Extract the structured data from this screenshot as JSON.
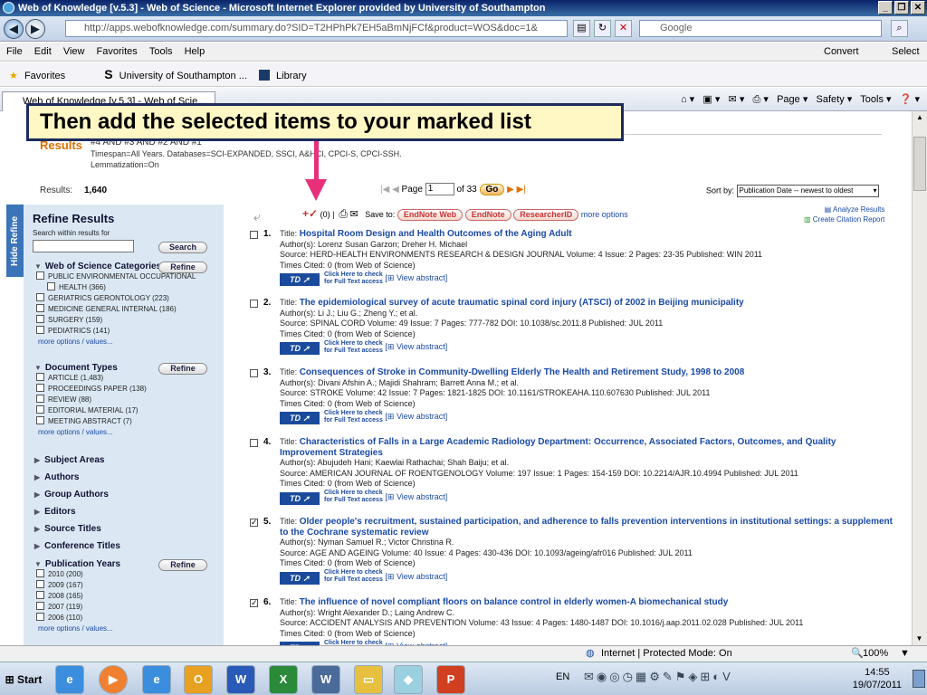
{
  "browser": {
    "window_title": "Web of Knowledge [v.5.3] - Web of Science - Microsoft Internet Explorer provided by University of Southampton",
    "url": "http://apps.webofknowledge.com/summary.do?SID=T2HPhPk7EH5aBmNjFCf&product=WOS&doc=1&",
    "search_box": "Google",
    "menu": [
      "File",
      "Edit",
      "View",
      "Favorites",
      "Tools",
      "Help"
    ],
    "convert_label": "Convert",
    "select_label": "Select",
    "favorites_label": "Favorites",
    "favorite_links": [
      "University of Southampton ...",
      "Library"
    ],
    "tab_title": "Web of Knowledge [v.5.3] - Web of Scie...",
    "toolbar_items": [
      "Page",
      "Safety",
      "Tools"
    ],
    "status_zone": "Internet | Protected Mode: On",
    "zoom": "100%"
  },
  "taskbar": {
    "start": "Start",
    "lang": "EN",
    "time": "14:55",
    "date": "19/07/2011"
  },
  "callout": {
    "text": "Then add the selected items to your marked list"
  },
  "search_summary": {
    "results_label": "Results",
    "query": "#4 AND #3 AND #2 AND #1",
    "timespan": "Timespan=All Years. Databases=SCI-EXPANDED, SSCI, A&HCI, CPCI-S, CPCI-SSH.",
    "lemmatization": "Lemmatization=On",
    "results_count_label": "Results:",
    "results_count": "1,640",
    "page_label": "Page",
    "page_value": "1",
    "of_pages": "of 33",
    "go": "Go",
    "sort_label": "Sort by:",
    "sort_value": "Publication Date -- newest to oldest"
  },
  "toolbar": {
    "marked_count": "(0)",
    "save_to": "Save to:",
    "endnote_web": "EndNote Web",
    "endnote": "EndNote",
    "researcherid": "ResearcherID",
    "more_options": "more options",
    "analyze": "Analyze Results",
    "citation_report": "Create Citation Report"
  },
  "sidebar": {
    "hide_tab": "Hide Refine",
    "title": "Refine Results",
    "search_within": "Search within results for",
    "search_btn": "Search",
    "refine_btn": "Refine",
    "more": "more options / values...",
    "categories": {
      "label": "Web of Science Categories",
      "items": [
        "PUBLIC ENVIRONMENTAL OCCUPATIONAL",
        "HEALTH (366)",
        "GERIATRICS GERONTOLOGY (223)",
        "MEDICINE GENERAL INTERNAL (186)",
        "SURGERY (159)",
        "PEDIATRICS (141)"
      ]
    },
    "doctypes": {
      "label": "Document Types",
      "items": [
        "ARTICLE (1,483)",
        "PROCEEDINGS PAPER (138)",
        "REVIEW (88)",
        "EDITORIAL MATERIAL (17)",
        "MEETING ABSTRACT (7)"
      ]
    },
    "collapsed": [
      "Subject Areas",
      "Authors",
      "Group Authors",
      "Editors",
      "Source Titles",
      "Conference Titles"
    ],
    "years": {
      "label": "Publication Years",
      "items": [
        "2010 (200)",
        "2009 (167)",
        "2008 (165)",
        "2007 (119)",
        "2006 (110)"
      ]
    }
  },
  "labels": {
    "title": "Title:",
    "authors": "Author(s):",
    "source": "Source:",
    "times_cited": "Times Cited:",
    "ft_line1": "Click Here to check",
    "ft_line2": "for Full Text access",
    "view_abstract": "View abstract"
  },
  "records": [
    {
      "num": "1.",
      "checked": false,
      "title": "Hospital Room Design and Health Outcomes of the Aging Adult",
      "authors": "Lorenz Susan Garzon; Dreher H. Michael",
      "source": "HERD-HEALTH ENVIRONMENTS RESEARCH & DESIGN JOURNAL  Volume: 4  Issue: 2  Pages: 23-35  Published: WIN 2011",
      "cited": "0 (from Web of Science)"
    },
    {
      "num": "2.",
      "checked": false,
      "title": "The epidemiological survey of acute traumatic spinal cord injury (ATSCI) of 2002 in Beijing municipality",
      "authors": "Li J.; Liu G.; Zheng Y.; et al.",
      "source": "SPINAL CORD  Volume: 49  Issue: 7  Pages: 777-782  DOI: 10.1038/sc.2011.8  Published: JUL 2011",
      "cited": "0 (from Web of Science)"
    },
    {
      "num": "3.",
      "checked": false,
      "title": "Consequences of Stroke in Community-Dwelling Elderly The Health and Retirement Study, 1998 to 2008",
      "authors": "Divani Afshin A.; Majidi Shahram; Barrett Anna M.; et al.",
      "source": "STROKE  Volume: 42  Issue: 7  Pages: 1821-1825  DOI: 10.1161/STROKEAHA.110.607630  Published: JUL 2011",
      "cited": "0 (from Web of Science)"
    },
    {
      "num": "4.",
      "checked": false,
      "title": "Characteristics of Falls in a Large Academic Radiology Department: Occurrence, Associated Factors, Outcomes, and Quality Improvement Strategies",
      "authors": "Abujudeh Hani; Kaewlai Rathachai; Shah Baiju; et al.",
      "source": "AMERICAN JOURNAL OF ROENTGENOLOGY  Volume: 197  Issue: 1  Pages: 154-159  DOI: 10.2214/AJR.10.4994  Published: JUL 2011",
      "cited": "0 (from Web of Science)"
    },
    {
      "num": "5.",
      "checked": true,
      "title": "Older people's recruitment, sustained participation, and adherence to falls prevention interventions in institutional settings: a supplement to the Cochrane systematic review",
      "authors": "Nyman Samuel R.; Victor Christina R.",
      "source": "AGE AND AGEING  Volume: 40  Issue: 4  Pages: 430-436  DOI: 10.1093/ageing/afr016  Published: JUL 2011",
      "cited": "0 (from Web of Science)"
    },
    {
      "num": "6.",
      "checked": true,
      "title": "The influence of novel compliant floors on balance control in elderly women-A biomechanical study",
      "authors": "Wright Alexander D.; Laing Andrew C.",
      "source": "ACCIDENT ANALYSIS AND PREVENTION  Volume: 43  Issue: 4  Pages: 1480-1487  DOI: 10.1016/j.aap.2011.02.028  Published: JUL 2011",
      "cited": "0 (from Web of Science)"
    }
  ],
  "colors": {
    "link": "#1a4aa8",
    "accent": "#e07000",
    "arrow": "#e8307a",
    "sidebar": "#dbe8f4"
  }
}
